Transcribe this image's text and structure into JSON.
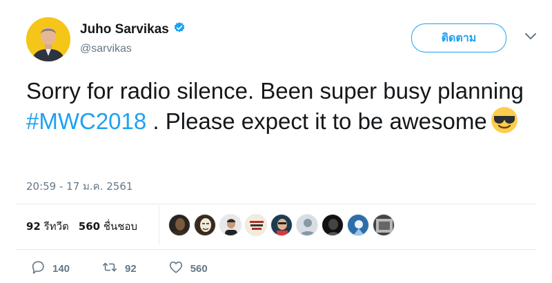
{
  "user": {
    "display_name": "Juho Sarvikas",
    "handle": "@sarvikas",
    "verified_icon": "verified-badge-icon"
  },
  "follow_button": {
    "label": "ติดตาม"
  },
  "tweet": {
    "text_part1": "Sorry for radio silence. Been super busy planning ",
    "hashtag": "#MWC2018",
    "text_part2": " . Please expect it to be awesome",
    "emoji": "smiling-face-with-sunglasses",
    "timestamp": "20:59 - 17 ม.ค. 2561"
  },
  "stats": {
    "retweets_count": "92",
    "retweets_label": "รีทวีต",
    "likes_count": "560",
    "likes_label": "ชื่นชอบ"
  },
  "actions": {
    "reply_count": "140",
    "retweet_count": "92",
    "like_count": "560"
  },
  "colors": {
    "accent": "#1da1f2",
    "text": "#14171a",
    "muted": "#657786",
    "avatar_bg": "#f5c518"
  }
}
